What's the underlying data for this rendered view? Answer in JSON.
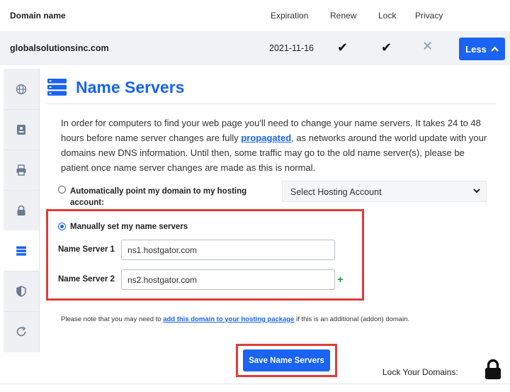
{
  "table_header": {
    "domain": "Domain name",
    "expiration": "Expiration",
    "renew": "Renew",
    "lock": "Lock",
    "privacy": "Privacy"
  },
  "domain_row": {
    "name": "globalsolutionsinc.com",
    "expiration": "2021-11-16",
    "renew_icon": "check-icon",
    "lock_icon": "check-icon",
    "privacy_icon": "x-icon",
    "less_label": "Less"
  },
  "sidebar": {
    "items": [
      {
        "icon": "globe-icon"
      },
      {
        "icon": "contact-card-icon"
      },
      {
        "icon": "printer-icon"
      },
      {
        "icon": "padlock-icon"
      },
      {
        "icon": "server-icon",
        "active": true
      },
      {
        "icon": "shield-icon"
      },
      {
        "icon": "refresh-icon"
      }
    ]
  },
  "panel": {
    "title": "Name Servers",
    "description_before": "In order for computers to find your web page you'll need to change your name servers. It takes 24 to 48 hours before name server changes are fully ",
    "description_link": "propagated",
    "description_after": ", as networks around the world update with your domains new DNS information. Until then, some traffic may go to the old name server(s), please be patient once name server changes are made as this is normal.",
    "auto_option_label": "Automatically point my domain to my hosting account:",
    "select_value": "Select Hosting Account",
    "manual_option_label": "Manually set my name servers",
    "ns1_label": "Name Server 1",
    "ns1_value": "ns1.hostgator.com",
    "ns2_label": "Name Server 2",
    "ns2_value": "ns2.hostgator.com",
    "add_symbol": "+",
    "note_before": "Please note that you may need to ",
    "note_link": "add this domain to your hosting package",
    "note_after": " if this is an additional (addon) domain.",
    "save_label": "Save Name Servers",
    "lock_domains_label": "Lock Your Domains:"
  },
  "colors": {
    "accent": "#1a63f3",
    "highlight": "#e23b3b",
    "plus": "#2e9b3e"
  }
}
